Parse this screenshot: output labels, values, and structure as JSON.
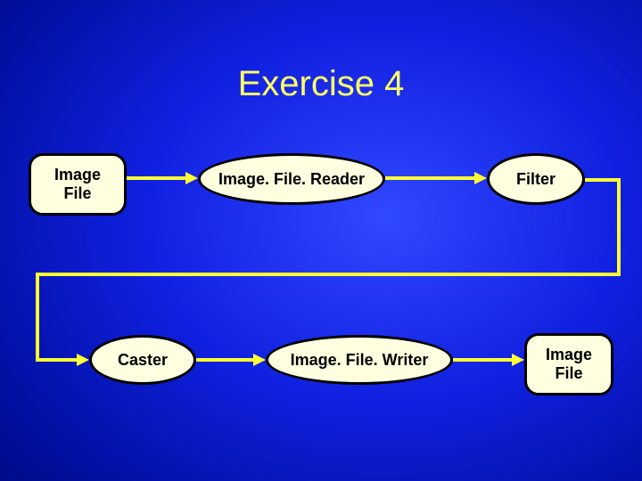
{
  "title": "Exercise 4",
  "nodes": {
    "image_file_in": "Image\nFile",
    "reader": "Image. File. Reader",
    "filter": "Filter",
    "caster": "Caster",
    "writer": "Image. File. Writer",
    "image_file_out": "Image\nFile"
  }
}
